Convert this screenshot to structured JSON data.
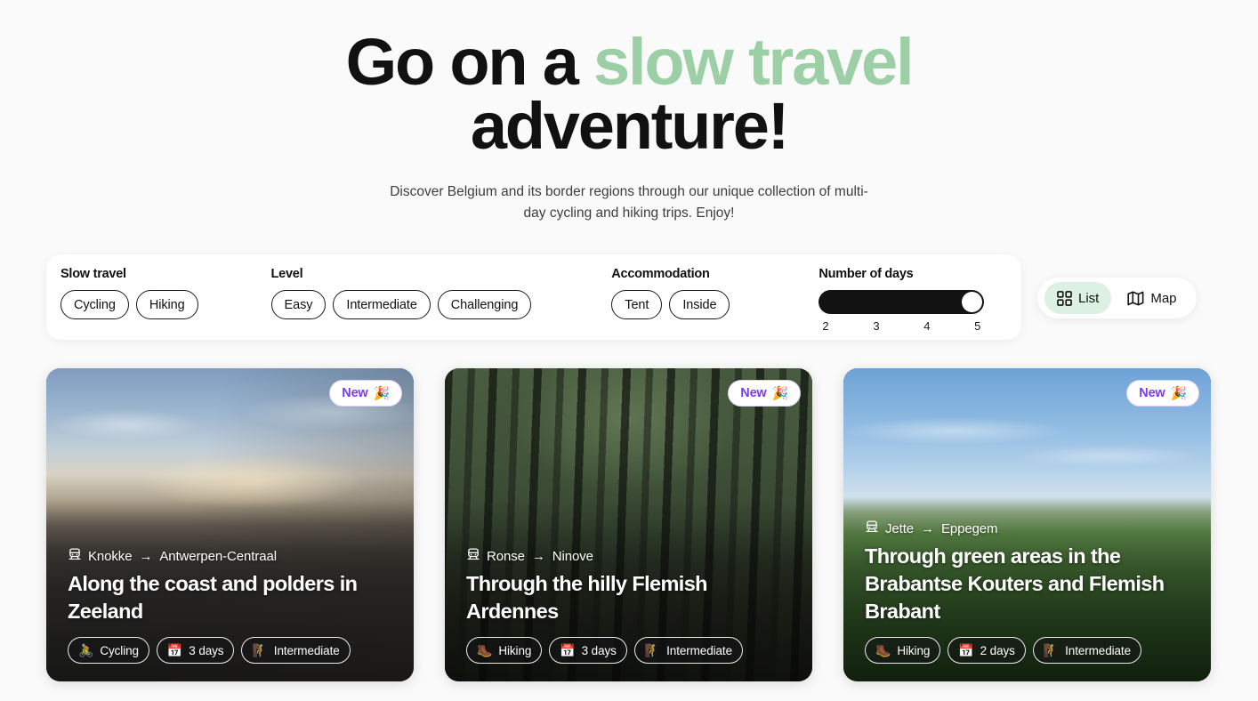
{
  "hero": {
    "title_part1": "Go on a ",
    "title_accent": "slow travel",
    "title_part2": "adventure!",
    "subtitle": "Discover Belgium and its border regions through our unique collection of multi-day cycling and hiking trips. Enjoy!",
    "accent_color": "#9ccfa6"
  },
  "filters": {
    "groups": [
      {
        "label": "Slow travel",
        "options": [
          "Cycling",
          "Hiking"
        ]
      },
      {
        "label": "Level",
        "options": [
          "Easy",
          "Intermediate",
          "Challenging"
        ]
      },
      {
        "label": "Accommodation",
        "options": [
          "Tent",
          "Inside"
        ]
      }
    ],
    "days": {
      "label": "Number of days",
      "ticks": [
        "2",
        "3",
        "4",
        "5"
      ],
      "min": 2,
      "max": 5,
      "value": 5
    }
  },
  "view_toggle": {
    "options": [
      {
        "label": "List",
        "icon": "grid-icon",
        "active": true
      },
      {
        "label": "Map",
        "icon": "map-icon",
        "active": false
      }
    ],
    "active_bg": "#ddf0e4"
  },
  "badge": {
    "label": "New",
    "emoji": "🎉",
    "text_color": "#7c3aed",
    "border_color": "#ddd0f5"
  },
  "cards": [
    {
      "from": "Knokke",
      "to": "Antwerpen-Centraal",
      "arrow": "→",
      "title": "Along the coast and polders in Zeeland",
      "new": true,
      "tags": [
        {
          "emoji": "🚴",
          "label": "Cycling"
        },
        {
          "emoji": "📅",
          "label": "3 days"
        },
        {
          "emoji": "🧗",
          "label": "Intermediate"
        }
      ]
    },
    {
      "from": "Ronse",
      "to": "Ninove",
      "arrow": "→",
      "title": "Through the hilly Flemish Ardennes",
      "new": true,
      "tags": [
        {
          "emoji": "🥾",
          "label": "Hiking"
        },
        {
          "emoji": "📅",
          "label": "3 days"
        },
        {
          "emoji": "🧗",
          "label": "Intermediate"
        }
      ]
    },
    {
      "from": "Jette",
      "to": "Eppegem",
      "arrow": "→",
      "title": "Through green areas in the Brabantse Kouters and Flemish Brabant",
      "new": true,
      "tags": [
        {
          "emoji": "🥾",
          "label": "Hiking"
        },
        {
          "emoji": "📅",
          "label": "2 days"
        },
        {
          "emoji": "🧗",
          "label": "Intermediate"
        }
      ]
    }
  ]
}
